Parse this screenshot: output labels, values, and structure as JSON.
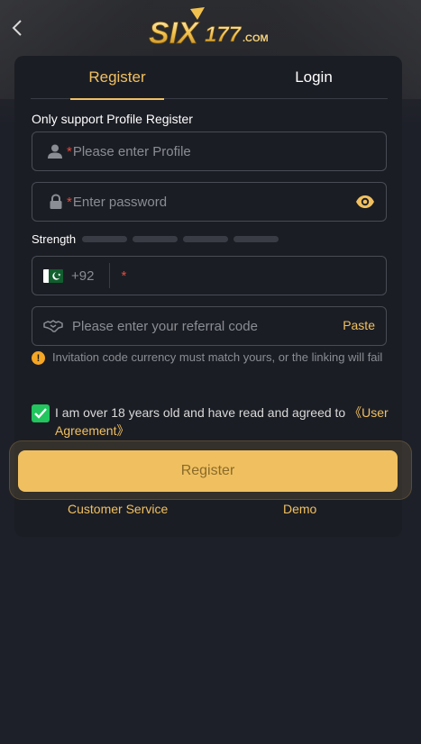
{
  "header": {
    "logo_text": "SIX177.COM"
  },
  "tabs": {
    "register": "Register",
    "login": "Login"
  },
  "form": {
    "section_label": "Only support Profile Register",
    "profile": {
      "required": "*",
      "placeholder": "Please enter Profile"
    },
    "password": {
      "required": "*",
      "placeholder": "Enter password"
    },
    "strength_label": "Strength",
    "phone": {
      "country_code": "+92",
      "required": "*"
    },
    "referral": {
      "placeholder": "Please enter your referral code",
      "paste_label": "Paste"
    },
    "invitation_hint": "Invitation code currency must match yours, or the linking will fail",
    "agreement": {
      "checked": true,
      "text": "I am over 18 years old and have read and agreed to ",
      "link": "《User Agreement》"
    },
    "submit_label": "Register"
  },
  "footer_links": {
    "customer_service": "Customer Service",
    "demo": "Demo"
  },
  "colors": {
    "accent": "#f0c060",
    "background": "#1e2029",
    "card": "#1b1d24",
    "required": "#e64a3b",
    "checkbox": "#22c55e",
    "warning": "#f5a623"
  },
  "icons": {
    "back": "chevron-left-icon",
    "profile": "user-icon",
    "password": "lock-icon",
    "visibility": "eye-icon",
    "flag": "pakistan-flag-icon",
    "referral": "handshake-icon",
    "hint": "warning-icon",
    "checkbox": "check-icon"
  }
}
